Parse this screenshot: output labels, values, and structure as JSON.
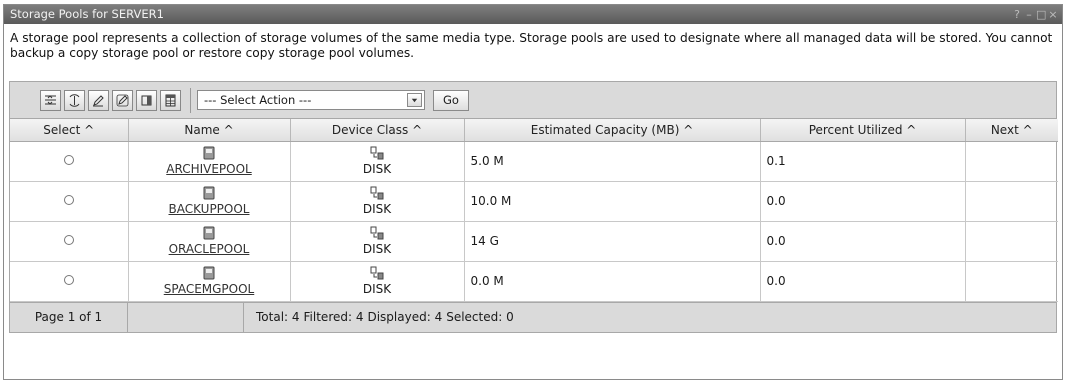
{
  "window": {
    "title": "Storage Pools for SERVER1",
    "controls": [
      "?",
      "–",
      "□",
      "×"
    ]
  },
  "description": "A storage pool represents a collection of storage volumes of the same media type. Storage pools are used to designate where all managed data will be stored. You cannot backup a copy storage pool or restore copy storage pool volumes.",
  "toolbar": {
    "buttons": [
      "select-all-icon",
      "deselect-all-icon",
      "edit-icon",
      "clear-icon",
      "column-icon",
      "table-icon"
    ],
    "action_select": "--- Select Action ---",
    "go_label": "Go"
  },
  "table": {
    "headers": {
      "select": "Select ^",
      "name": "Name ^",
      "device_class": "Device Class ^",
      "capacity": "Estimated Capacity (MB) ^",
      "percent": "Percent Utilized ^",
      "next": "Next ^"
    },
    "rows": [
      {
        "name": "ARCHIVEPOOL",
        "device_class": "DISK",
        "capacity": "5.0 M",
        "percent": "0.1",
        "next": ""
      },
      {
        "name": "BACKUPPOOL",
        "device_class": "DISK",
        "capacity": "10.0 M",
        "percent": "0.0",
        "next": ""
      },
      {
        "name": "ORACLEPOOL",
        "device_class": "DISK",
        "capacity": "14 G",
        "percent": "0.0",
        "next": ""
      },
      {
        "name": "SPACEMGPOOL",
        "device_class": "DISK",
        "capacity": "0.0 M",
        "percent": "0.0",
        "next": ""
      }
    ]
  },
  "footer": {
    "page": "Page 1 of 1",
    "total": "Total: 4",
    "filtered": "Filtered: 4",
    "displayed": "Displayed: 4",
    "selected": "Selected: 0"
  }
}
